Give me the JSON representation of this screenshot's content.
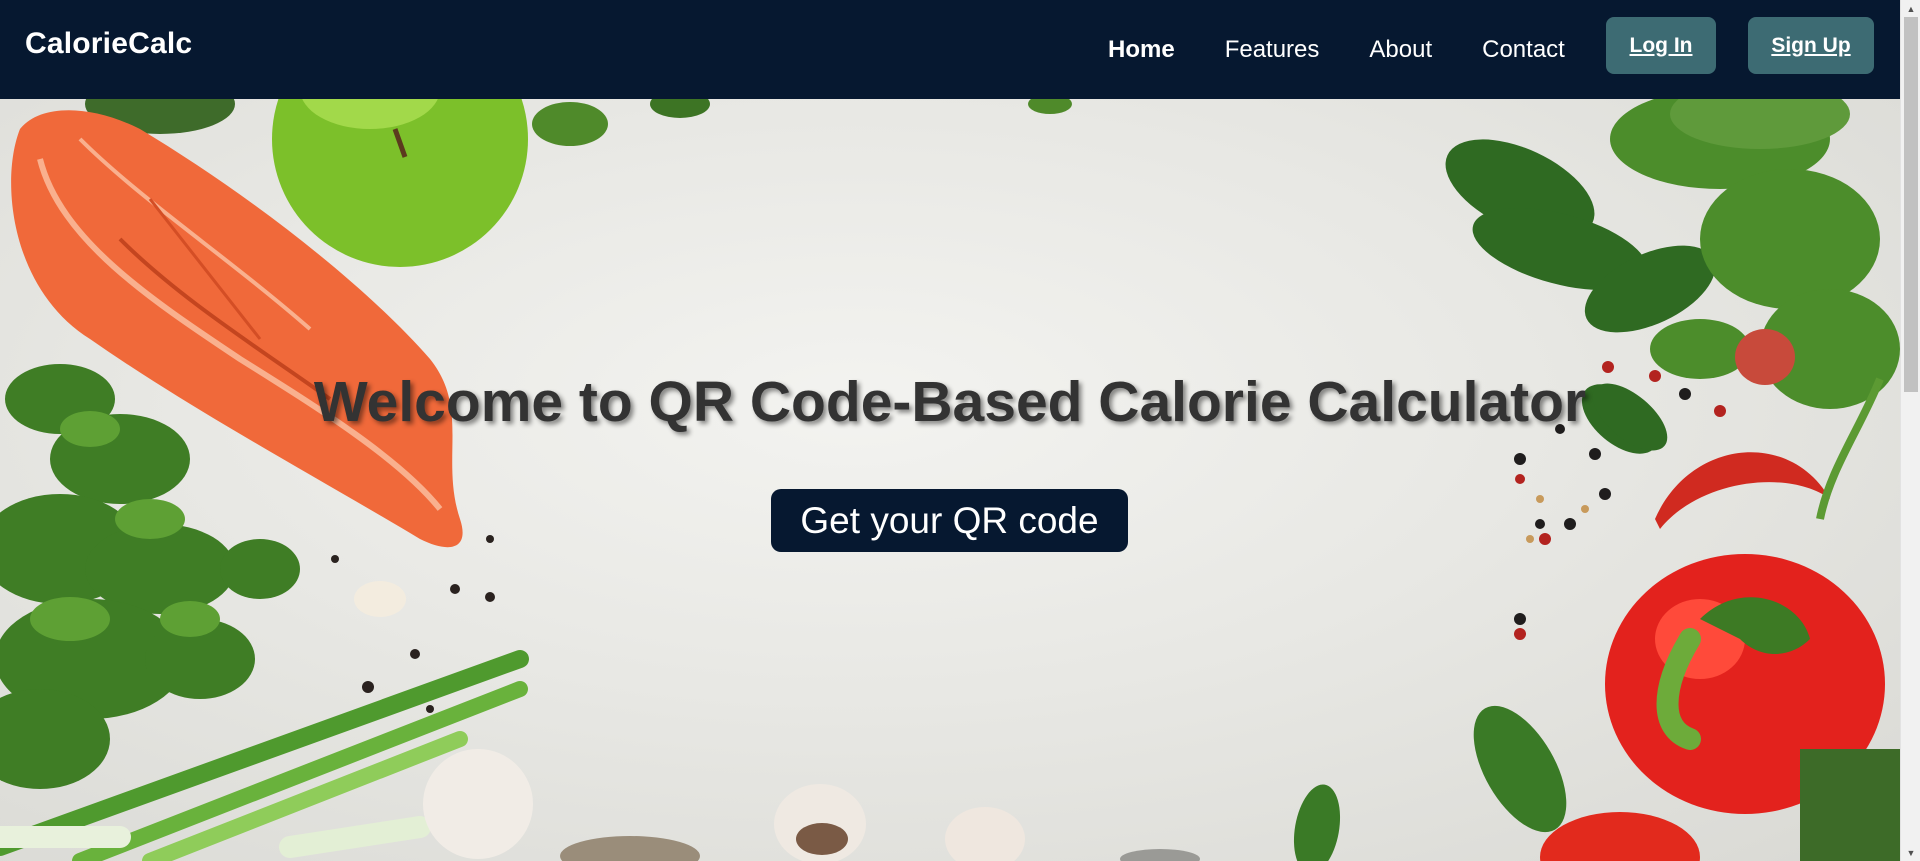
{
  "nav": {
    "brand": "CalorieCalc",
    "links": [
      "Home",
      "Features",
      "About",
      "Contact"
    ],
    "active": "Home",
    "login_label": "Log In",
    "signup_label": "Sign Up"
  },
  "hero": {
    "title": "Welcome to QR Code-Based Calorie Calculator",
    "cta_label": "Get your QR code"
  },
  "colors": {
    "navbar_bg": "#061830",
    "auth_button_bg": "#3d6b73",
    "cta_bg": "#061830",
    "title_text": "#333333"
  }
}
